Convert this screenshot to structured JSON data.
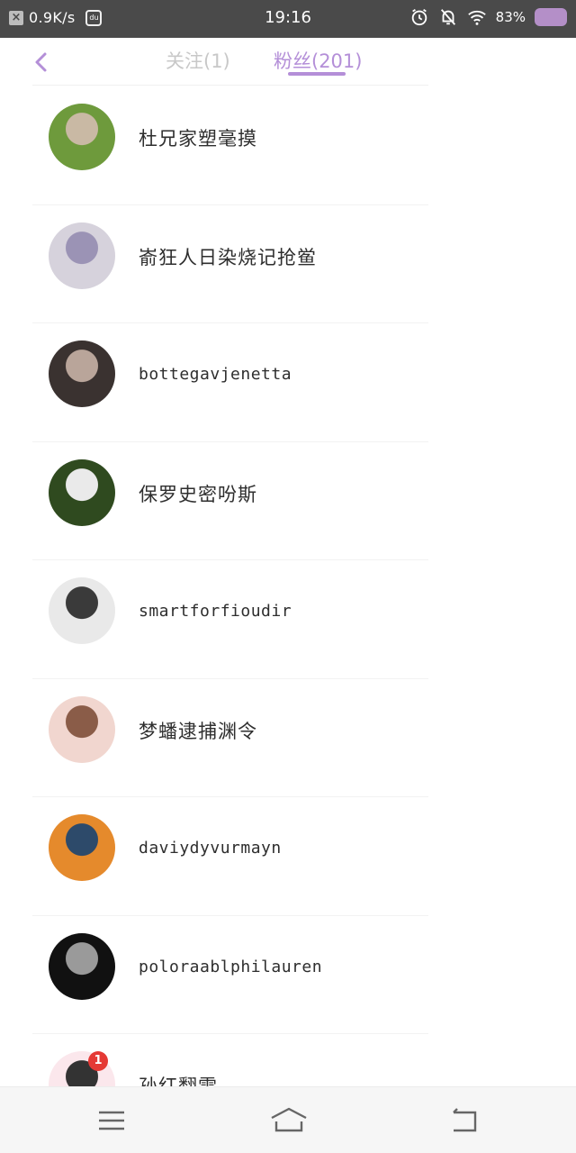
{
  "status_bar": {
    "net_speed": "0.9K/s",
    "time": "19:16",
    "battery": "83%"
  },
  "header": {
    "tab_following": "关注(1)",
    "tab_fans": "粉丝(201)"
  },
  "fans": [
    {
      "name": "杜兄家塑毫摸",
      "avatar_colors": [
        "#6e9a3c",
        "#c9b9a4"
      ]
    },
    {
      "name": "嵛狂人日染烧记抢鲎",
      "avatar_colors": [
        "#d6d2dc",
        "#9b93b5"
      ]
    },
    {
      "name": "bottegavjenetta",
      "avatar_colors": [
        "#3a3230",
        "#b9a59a"
      ]
    },
    {
      "name": "保罗史密吩斯",
      "avatar_colors": [
        "#2f4a1f",
        "#eaeaea"
      ]
    },
    {
      "name": "smartforfioudir",
      "avatar_colors": [
        "#e9e9e9",
        "#3a3a3a"
      ]
    },
    {
      "name": "梦蟠逮捕渊令",
      "avatar_colors": [
        "#f1d6cf",
        "#8a5c48"
      ]
    },
    {
      "name": "daviydyvurmayn",
      "avatar_colors": [
        "#e58a2c",
        "#2d4a6a"
      ]
    },
    {
      "name": "poloraablphilauren",
      "avatar_colors": [
        "#111111",
        "#9a9a9a"
      ]
    },
    {
      "name": "孙红翻雷",
      "avatar_colors": [
        "#fbe7ec",
        "#333333"
      ],
      "badge": "1"
    }
  ]
}
